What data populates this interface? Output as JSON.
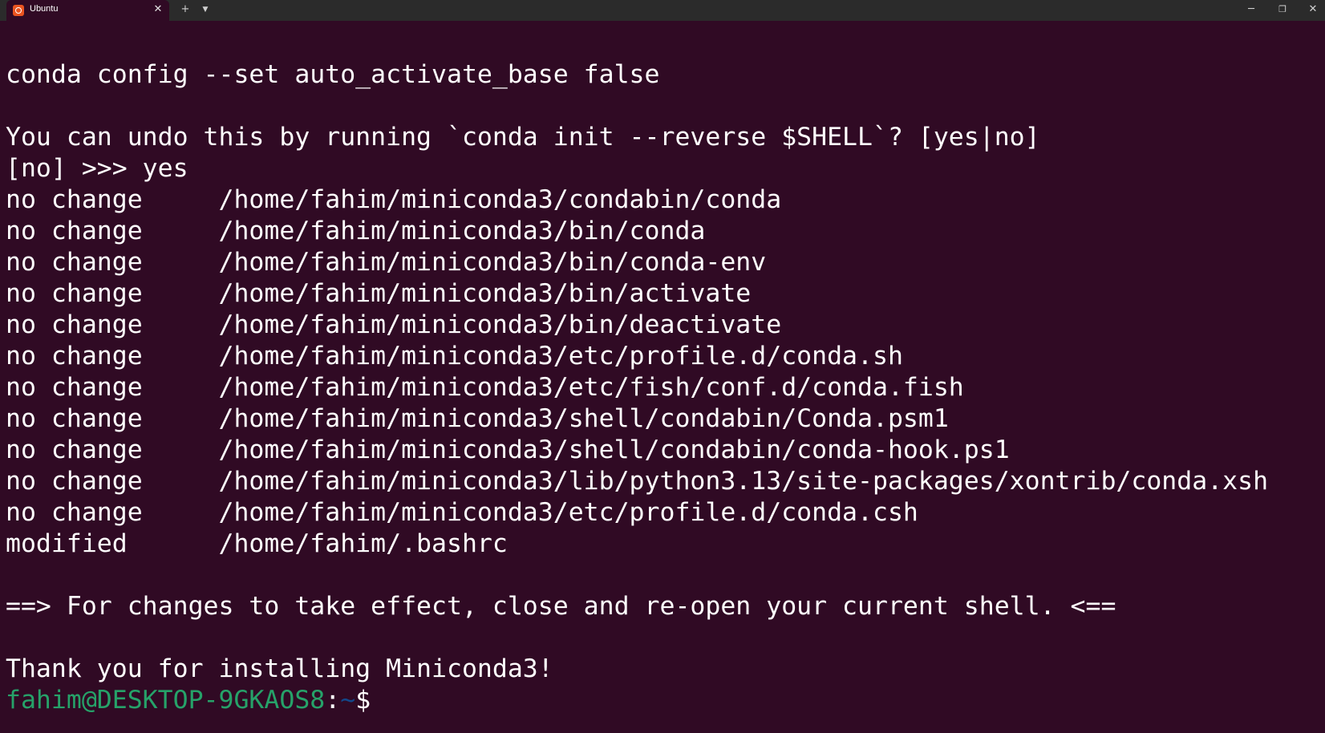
{
  "window": {
    "tab_title": "Ubuntu",
    "tab_close_icon": "close-icon",
    "new_tab_label": "+",
    "dropdown_label": "⌄",
    "minimize_label": "─",
    "maximize_label": "❐",
    "close_label": "✕"
  },
  "terminal": {
    "lines": [
      "conda config --set auto_activate_base false",
      "",
      "You can undo this by running `conda init --reverse $SHELL`? [yes|no]",
      "[no] >>> yes",
      "no change     /home/fahim/miniconda3/condabin/conda",
      "no change     /home/fahim/miniconda3/bin/conda",
      "no change     /home/fahim/miniconda3/bin/conda-env",
      "no change     /home/fahim/miniconda3/bin/activate",
      "no change     /home/fahim/miniconda3/bin/deactivate",
      "no change     /home/fahim/miniconda3/etc/profile.d/conda.sh",
      "no change     /home/fahim/miniconda3/etc/fish/conf.d/conda.fish",
      "no change     /home/fahim/miniconda3/shell/condabin/Conda.psm1",
      "no change     /home/fahim/miniconda3/shell/condabin/conda-hook.ps1",
      "no change     /home/fahim/miniconda3/lib/python3.13/site-packages/xontrib/conda.xsh",
      "no change     /home/fahim/miniconda3/etc/profile.d/conda.csh",
      "modified      /home/fahim/.bashrc",
      "",
      "==> For changes to take effect, close and re-open your current shell. <==",
      "",
      "Thank you for installing Miniconda3!"
    ],
    "prompt": {
      "user_host": "fahim@DESKTOP-9GKAOS8",
      "separator": ":",
      "path": "~",
      "symbol": "$"
    }
  },
  "colors": {
    "background": "#300a24",
    "titlebar": "#2b2b2b",
    "prompt_user": "#26a269",
    "prompt_path": "#12488b",
    "text": "#ffffff"
  }
}
